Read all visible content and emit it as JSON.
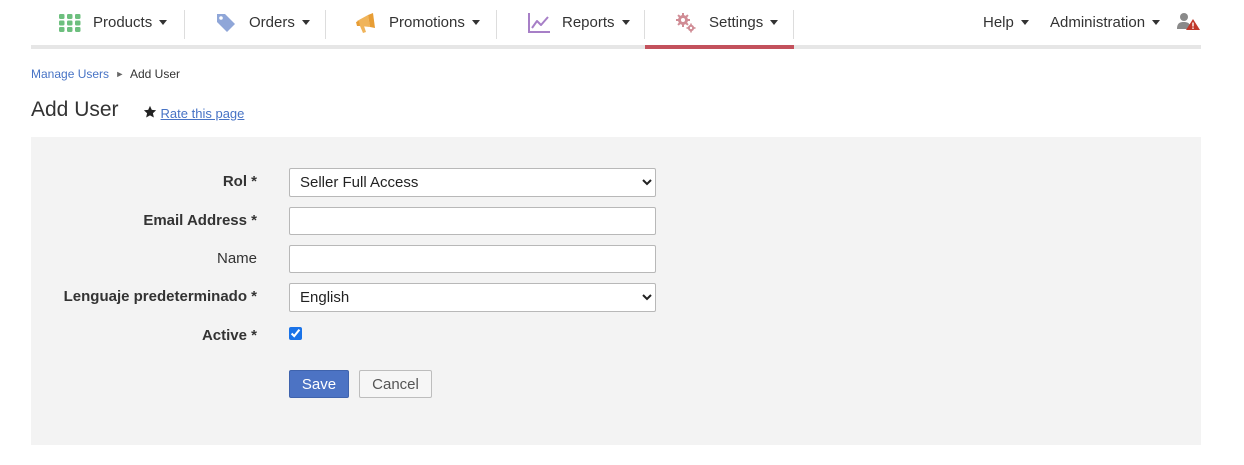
{
  "nav": {
    "products": {
      "label": "Products",
      "icon": "grid-icon"
    },
    "orders": {
      "label": "Orders",
      "icon": "tag-icon"
    },
    "promotions": {
      "label": "Promotions",
      "icon": "megaphone-icon"
    },
    "reports": {
      "label": "Reports",
      "icon": "line-chart-icon"
    },
    "settings": {
      "label": "Settings",
      "icon": "gears-icon"
    },
    "help": {
      "label": "Help"
    },
    "administration": {
      "label": "Administration"
    },
    "user": {
      "icon": "user-alert-icon"
    }
  },
  "colors": {
    "products_icon": "#6dbf7e",
    "orders_icon": "#8fa6d8",
    "promotions_icon": "#f0b45a",
    "reports_icon": "#a77fc7",
    "settings_icon": "#d08c95",
    "active_underline": "#c3515c",
    "link": "#4773c5",
    "primary_button": "#4c73c4",
    "alert": "#c0392b"
  },
  "breadcrumb": {
    "parent": "Manage Users",
    "separator": "►",
    "current": "Add User"
  },
  "page": {
    "title": "Add User",
    "rate_link": "Rate this page"
  },
  "form": {
    "rol": {
      "label": "Rol *",
      "selected": "Seller Full Access"
    },
    "email": {
      "label": "Email Address *",
      "value": "",
      "placeholder": ""
    },
    "name": {
      "label": "Name",
      "value": "",
      "placeholder": ""
    },
    "language": {
      "label": "Lenguaje predeterminado *",
      "selected": "English"
    },
    "active": {
      "label": "Active *",
      "checked": true
    },
    "save_label": "Save",
    "cancel_label": "Cancel"
  }
}
